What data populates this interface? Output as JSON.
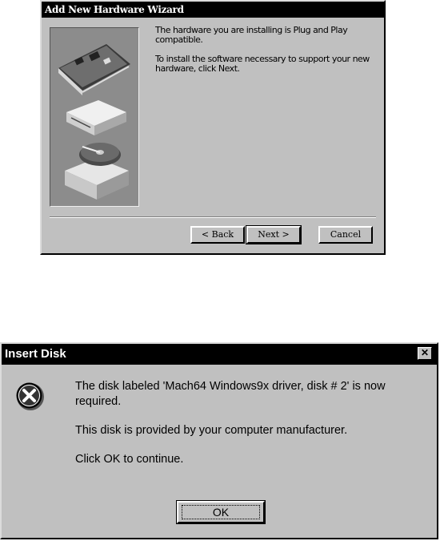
{
  "wizard": {
    "title": "Add New Hardware Wizard",
    "paragraph1": "The hardware you are installing is Plug and Play compatible.",
    "paragraph2": "To install the software necessary to support your new hardware, click Next.",
    "back_label": "< Back",
    "next_label": "Next >",
    "cancel_label": "Cancel"
  },
  "insert_disk": {
    "title": "Insert Disk",
    "close_glyph": "✕",
    "line1": "The disk labeled 'Mach64 Windows9x driver, disk # 2' is now required.",
    "line2": "This disk is provided by your computer manufacturer.",
    "line3": "Click OK to continue.",
    "ok_label": "OK",
    "icon": "error-icon"
  }
}
